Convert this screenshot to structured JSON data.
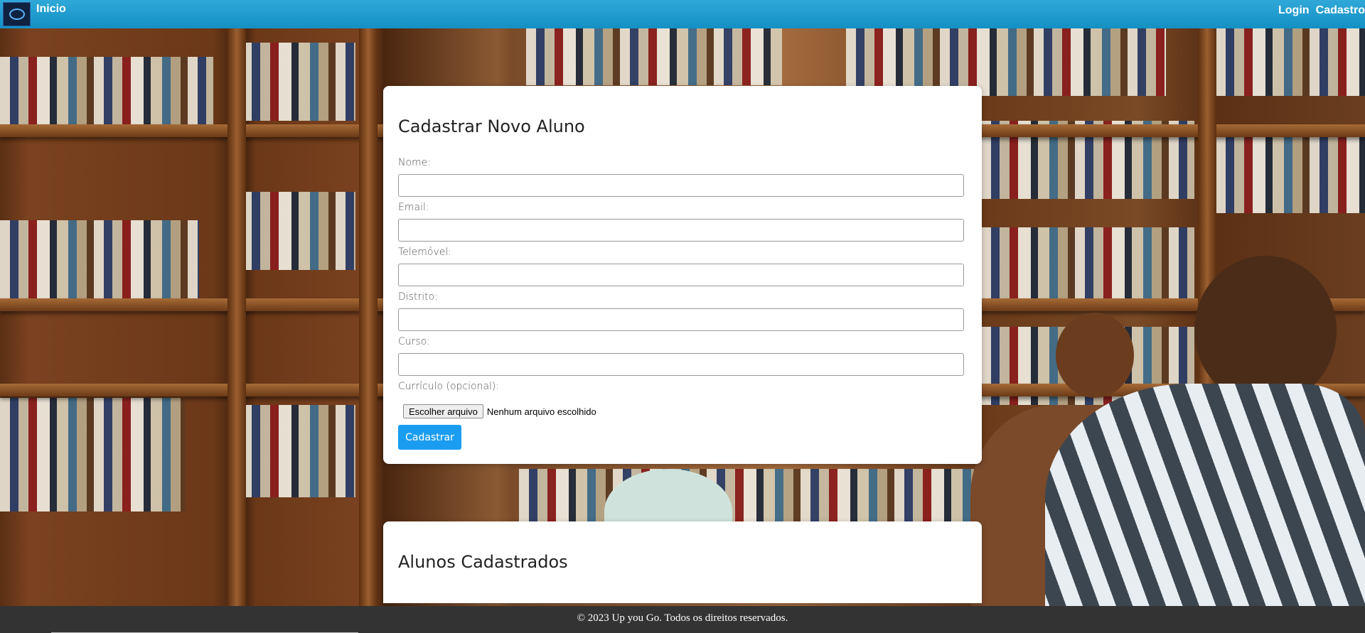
{
  "nav": {
    "home_label": "Inicio",
    "login_label": "Login",
    "register_label": "Cadastro"
  },
  "form": {
    "title": "Cadastrar Novo Aluno",
    "fields": {
      "nome": {
        "label": "Nome:",
        "value": ""
      },
      "email": {
        "label": "Email:",
        "value": ""
      },
      "telemovel": {
        "label": "Telemóvel:",
        "value": ""
      },
      "distrito": {
        "label": "Distrito:",
        "value": ""
      },
      "curso": {
        "label": "Curso:",
        "value": ""
      }
    },
    "curriculo_label": "Currículo (opcional):",
    "file_button_label": "Escolher arquivo",
    "file_status": "Nenhum arquivo escolhido",
    "submit_label": "Cadastrar"
  },
  "list": {
    "title": "Alunos Cadastrados"
  },
  "footer": {
    "text": "© 2023 Up you Go. Todos os direitos reservados."
  },
  "colors": {
    "topbar": "#1490c4",
    "primary_button": "#1a9df0",
    "footer_bg": "#333333"
  }
}
